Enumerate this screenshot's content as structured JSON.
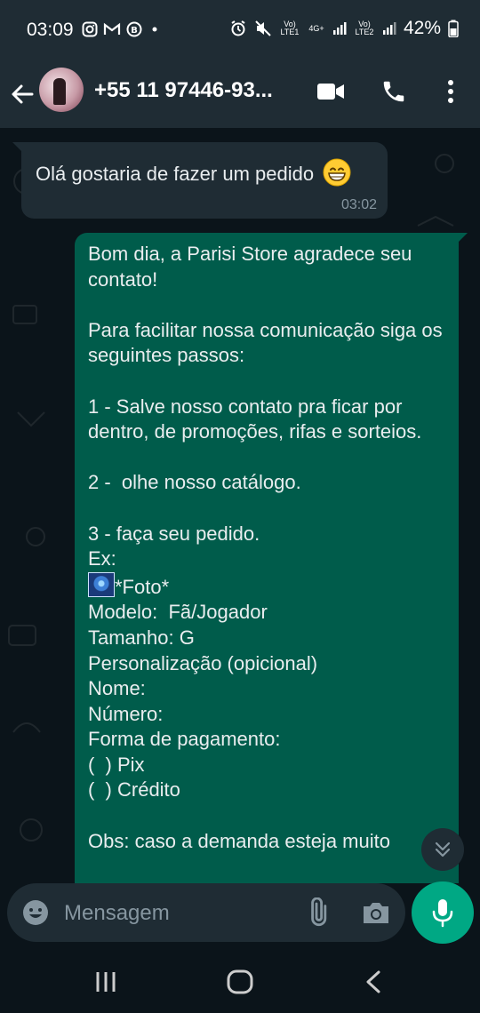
{
  "status_bar": {
    "time": "03:09",
    "battery": "42%",
    "sim1_label": "Vo) LTE1",
    "sim2_label": "Vo) LTE2",
    "network": "4G+"
  },
  "header": {
    "contact_name": "+55 11 97446-93..."
  },
  "messages": {
    "incoming": {
      "text": "Olá gostaria de fazer um pedido",
      "emoji": "😁",
      "time": "03:02"
    },
    "outgoing": {
      "part1": "Bom dia, a Parisi Store agradece seu contato!\n\nPara facilitar nossa comunicação siga os seguintes passos:\n\n1 - Salve nosso contato pra ficar por dentro, de promoções, rifas e sorteios.\n\n2 -  olhe nosso catálogo.\n\n3 - faça seu pedido.\nEx:\n",
      "photo_label": "*Foto*",
      "part2": "\nModelo:  Fã/Jogador\nTamanho: G\nPersonalização (opicional)\nNome:\nNúmero:\nForma de pagamento:\n(  ) Pix\n(  ) Crédito\n\nObs: caso a demanda esteja muito"
    }
  },
  "composer": {
    "placeholder": "Mensagem"
  },
  "colors": {
    "outgoing_bubble": "#005c4b",
    "incoming_bubble": "#1f2c34",
    "accent": "#00a884"
  },
  "icons": {
    "back": "arrow-left-icon",
    "video": "video-call-icon",
    "call": "phone-icon",
    "menu": "more-vert-icon",
    "emoji": "emoji-icon",
    "attach": "paperclip-icon",
    "camera": "camera-icon",
    "mic": "mic-icon",
    "scroll": "chevron-double-down-icon"
  }
}
